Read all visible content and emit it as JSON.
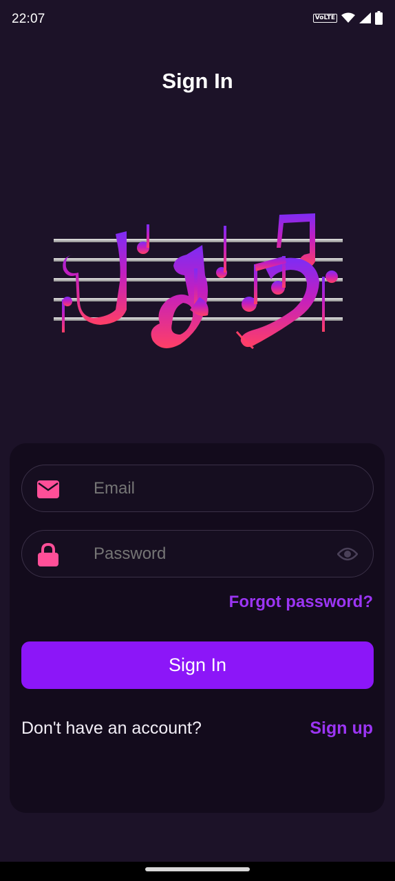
{
  "status_bar": {
    "time": "22:07",
    "network_badge": "VoLTE",
    "icons": [
      "volte-icon",
      "wifi-icon",
      "signal-icon",
      "battery-icon"
    ]
  },
  "page": {
    "title": "Sign In"
  },
  "form": {
    "email": {
      "placeholder": "Email",
      "value": "",
      "icon": "envelope-icon"
    },
    "password": {
      "placeholder": "Password",
      "value": "",
      "icon": "lock-icon",
      "toggle_icon": "eye-icon"
    },
    "forgot_label": "Forgot password?",
    "submit_label": "Sign In",
    "no_account_text": "Don't have an account?",
    "signup_label": "Sign up"
  },
  "colors": {
    "background": "#1c1228",
    "card": "#130b1c",
    "accent": "#8c16f8",
    "link": "#9b35f3",
    "icon_pink": "#ff4f98",
    "logo_gradient": [
      "#8c2cf5",
      "#ff3f6e"
    ]
  }
}
